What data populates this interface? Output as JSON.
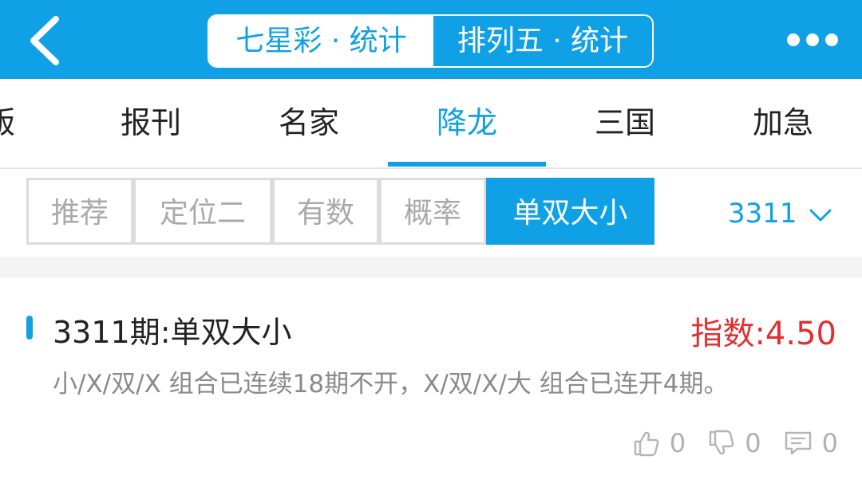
{
  "header": {
    "segments": [
      "七星彩 · 统计",
      "排列五 · 统计"
    ],
    "active_segment": 1,
    "colors": {
      "accent": "#10a0e6"
    }
  },
  "nav": {
    "items": [
      "版",
      "报刊",
      "名家",
      "降龙",
      "三国",
      "加急"
    ],
    "active": "降龙"
  },
  "filters": {
    "chips": [
      "推荐",
      "定位二",
      "有数",
      "概率",
      "单双大小"
    ],
    "active": "单双大小",
    "issue": "3311"
  },
  "card": {
    "title": "3311期:单双大小",
    "index": "指数:4.50",
    "description": "小/X/双/X 组合已连续18期不开，X/双/X/大 组合已连开4期。",
    "likes": "0",
    "dislikes": "0",
    "comments": "0",
    "index_color": "#e03030"
  },
  "icons": [
    "back-arrow-icon",
    "more-icon",
    "chevron-down-icon",
    "thumbs-up-icon",
    "thumbs-down-icon",
    "comment-icon"
  ]
}
